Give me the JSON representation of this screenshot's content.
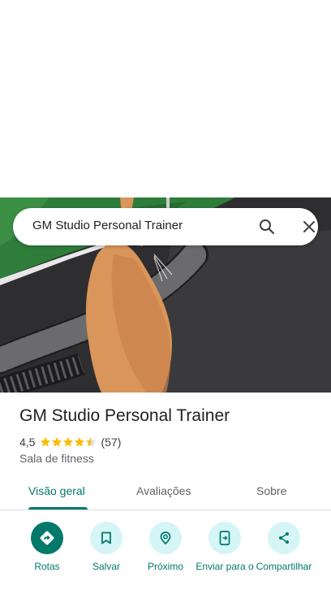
{
  "search": {
    "query": "GM Studio Personal Trainer"
  },
  "place": {
    "name": "GM Studio Personal Trainer",
    "rating": "4,5",
    "rating_value": 4.5,
    "review_count": "(57)",
    "category": "Sala de fitness"
  },
  "tabs": [
    {
      "label": "Visão geral",
      "active": true
    },
    {
      "label": "Avaliações",
      "active": false
    },
    {
      "label": "Sobre",
      "active": false
    }
  ],
  "actions": [
    {
      "label": "Rotas",
      "icon": "directions-icon"
    },
    {
      "label": "Salvar",
      "icon": "bookmark-icon"
    },
    {
      "label": "Próximo",
      "icon": "nearby-icon"
    },
    {
      "label": "Enviar para o",
      "icon": "send-to-phone-icon"
    },
    {
      "label": "Compartilhar",
      "icon": "share-icon"
    }
  ],
  "colors": {
    "accent": "#00796b",
    "action_bg": "#d5f5f6",
    "star": "#fbbc04"
  }
}
